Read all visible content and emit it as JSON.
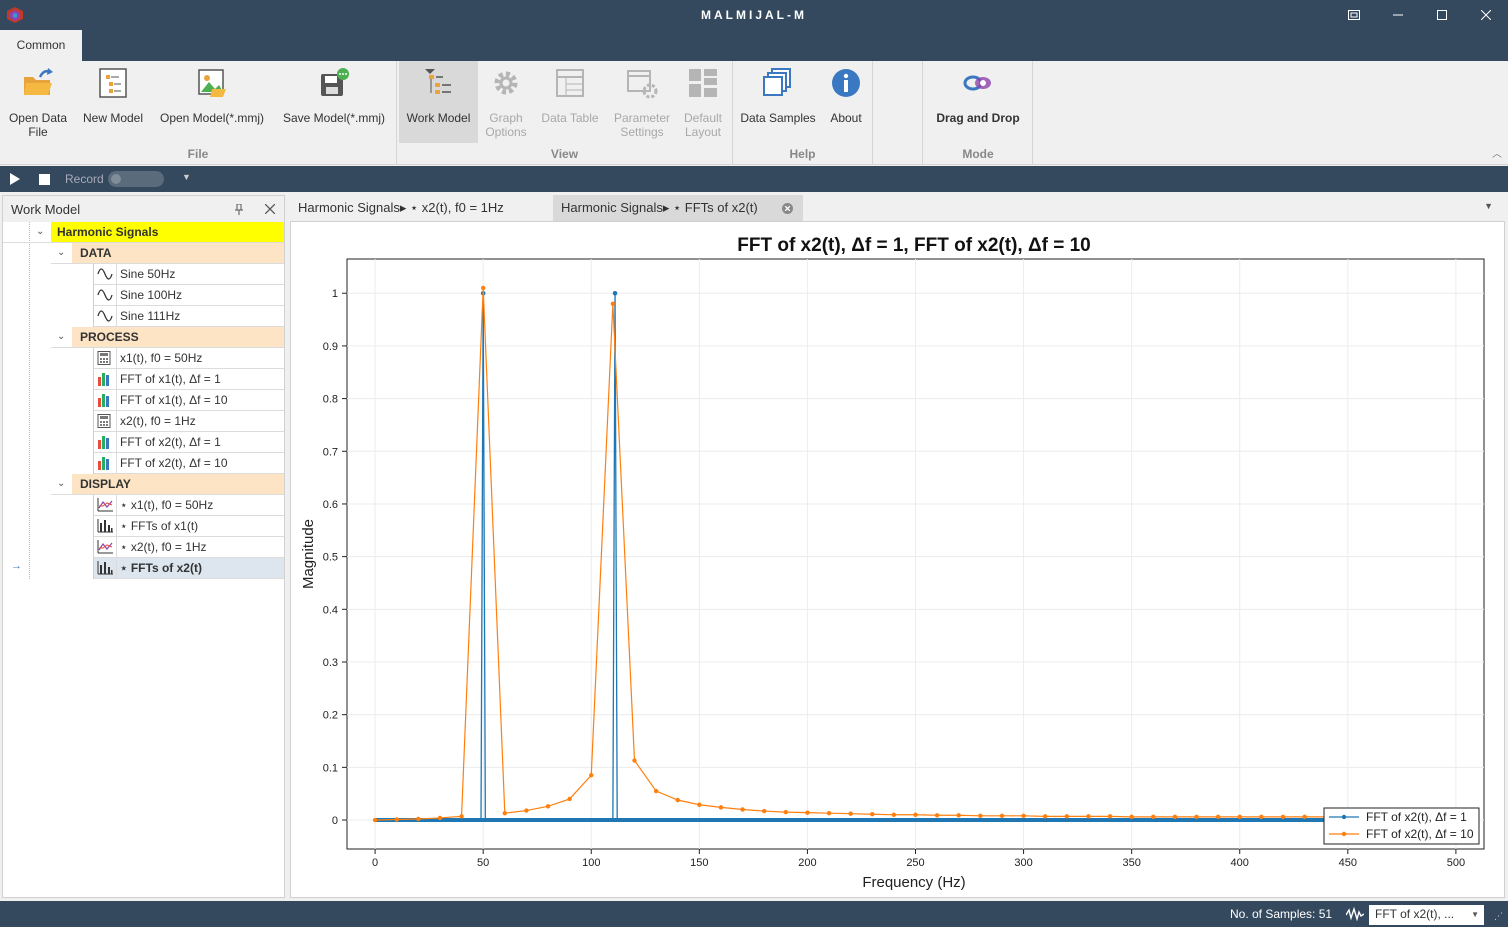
{
  "window": {
    "title": "MALMIJAL-M"
  },
  "ribbon_tabs": [
    "Common"
  ],
  "ribbon": {
    "file": {
      "group_label": "File",
      "open_data_file": "Open Data\nFile",
      "new_model": "New Model",
      "open_model": "Open Model(*.mmj)",
      "save_model": "Save Model(*.mmj)"
    },
    "view": {
      "group_label": "View",
      "work_model": "Work Model",
      "graph_options": "Graph\nOptions",
      "data_table": "Data Table",
      "parameter_settings": "Parameter\nSettings",
      "default_layout": "Default\nLayout"
    },
    "help": {
      "group_label": "Help",
      "data_samples": "Data Samples",
      "about": "About"
    },
    "mode": {
      "group_label": "Mode",
      "drag_and_drop": "Drag and Drop"
    }
  },
  "record_bar": {
    "record_label": "Record"
  },
  "work_model": {
    "title": "Work Model",
    "root": "Harmonic Signals",
    "sections": [
      {
        "name": "DATA",
        "items": [
          {
            "label": "Sine 50Hz",
            "icon": "sine-icon"
          },
          {
            "label": "Sine 100Hz",
            "icon": "sine-icon"
          },
          {
            "label": "Sine 111Hz",
            "icon": "sine-icon"
          }
        ]
      },
      {
        "name": "PROCESS",
        "items": [
          {
            "label": "x1(t), f0 = 50Hz",
            "icon": "calculator-icon"
          },
          {
            "label": "FFT of x1(t), Δf = 1",
            "icon": "bar-chart-icon"
          },
          {
            "label": "FFT of x1(t), Δf = 10",
            "icon": "bar-chart-icon"
          },
          {
            "label": "x2(t), f0 = 1Hz",
            "icon": "calculator-icon"
          },
          {
            "label": "FFT of x2(t), Δf = 1",
            "icon": "bar-chart-icon"
          },
          {
            "label": "FFT of x2(t), Δf = 10",
            "icon": "bar-chart-icon"
          }
        ]
      },
      {
        "name": "DISPLAY",
        "items": [
          {
            "label": "⋆ x1(t), f0 = 50Hz",
            "icon": "line-plot-icon"
          },
          {
            "label": "⋆ FFTs of x1(t)",
            "icon": "histogram-icon"
          },
          {
            "label": "⋆ x2(t), f0 = 1Hz",
            "icon": "line-plot-icon"
          },
          {
            "label": "⋆ FFTs of x2(t)",
            "icon": "histogram-icon",
            "selected": true
          }
        ]
      }
    ]
  },
  "doc_tabs": [
    {
      "label": "Harmonic Signals▸ ⋆ x2(t), f0 = 1Hz",
      "active": false
    },
    {
      "label": "Harmonic Signals▸ ⋆ FFTs of x2(t)",
      "active": true
    }
  ],
  "chart_data": {
    "type": "line",
    "title": "FFT of x2(t), Δf = 1, FFT of x2(t), Δf = 10",
    "xlabel": "Frequency (Hz)",
    "ylabel": "Magnitude",
    "xlim": [
      -13,
      513
    ],
    "ylim": [
      -0.055,
      1.065
    ],
    "xticks": [
      0,
      50,
      100,
      150,
      200,
      250,
      300,
      350,
      400,
      450,
      500
    ],
    "yticks": [
      0,
      0.1,
      0.2,
      0.3,
      0.4,
      0.5,
      0.6,
      0.7,
      0.8,
      0.9,
      1
    ],
    "grid": true,
    "legend_position": "bottom-right",
    "series": [
      {
        "name": "FFT of x2(t), Δf = 1",
        "color": "#1f77b4",
        "points": [
          [
            0,
            0
          ],
          [
            49,
            0
          ],
          [
            50,
            1
          ],
          [
            51,
            0
          ],
          [
            110,
            0
          ],
          [
            111,
            1
          ],
          [
            112,
            0
          ],
          [
            500,
            0
          ]
        ]
      },
      {
        "name": "FFT of x2(t), Δf = 10",
        "color": "#ff7f0e",
        "x": [
          0,
          10,
          20,
          30,
          40,
          50,
          60,
          70,
          80,
          90,
          100,
          110,
          120,
          130,
          140,
          150,
          160,
          170,
          180,
          190,
          200,
          210,
          220,
          230,
          240,
          250,
          260,
          270,
          280,
          290,
          300,
          310,
          320,
          330,
          340,
          350,
          360,
          370,
          380,
          390,
          400,
          410,
          420,
          430,
          440,
          450,
          460,
          470,
          480,
          490,
          500
        ],
        "y": [
          0,
          0.001,
          0.002,
          0.004,
          0.007,
          1.01,
          0.013,
          0.018,
          0.026,
          0.04,
          0.085,
          0.98,
          0.113,
          0.055,
          0.038,
          0.029,
          0.024,
          0.02,
          0.017,
          0.015,
          0.014,
          0.013,
          0.012,
          0.011,
          0.01,
          0.01,
          0.009,
          0.009,
          0.008,
          0.008,
          0.008,
          0.007,
          0.007,
          0.007,
          0.007,
          0.006,
          0.006,
          0.006,
          0.006,
          0.006,
          0.006,
          0.006,
          0.006,
          0.006,
          0.006,
          0.006,
          0.005,
          0.005,
          0.005,
          0.005,
          0.005
        ]
      }
    ]
  },
  "status": {
    "samples": "No. of Samples: 51",
    "combo": "FFT of x2(t), ..."
  }
}
